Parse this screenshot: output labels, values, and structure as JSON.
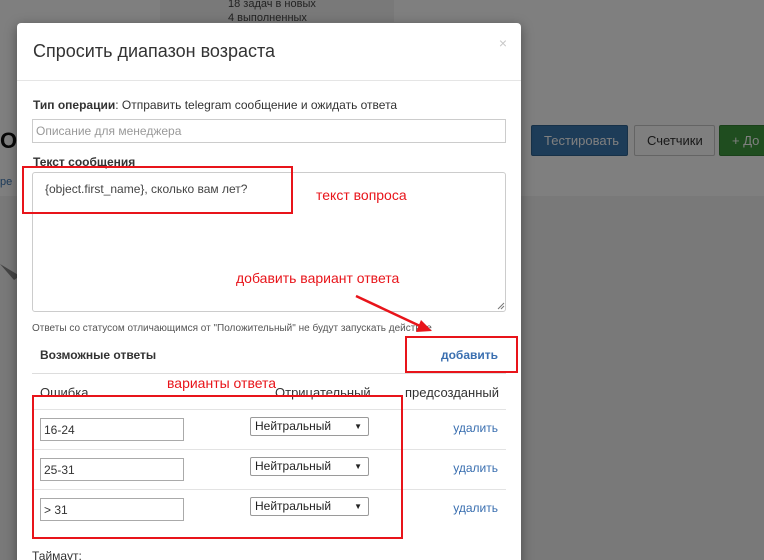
{
  "background": {
    "card_line1": "18 задач в новых",
    "card_line2": "4 выполненных",
    "heading": "О",
    "sub": "ре",
    "buttons": {
      "test": "Тестировать",
      "counters": "Счетчики",
      "add": "+ До"
    }
  },
  "modal": {
    "title": "Спросить диапазон возраста",
    "close": "×",
    "operation_label": "Тип операции",
    "operation_value": ": Отправить telegram сообщение и ожидать ответа",
    "description_placeholder": "Описание для менеджера",
    "message_label": "Текст сообщения",
    "message_text": "{object.first_name}, сколько вам лет?",
    "note": "Ответы со статусом отличающимся от \"Положительный\" не будут запускать действие",
    "answers_title": "Возможные ответы",
    "add_label": "добавить",
    "columns": {
      "error": "Ошибка",
      "negative": "Отрицательный",
      "precreated": "предсозданный"
    },
    "answers": [
      {
        "value": "16-24",
        "status": "Нейтральный",
        "delete_label": "удалить"
      },
      {
        "value": "25-31",
        "status": "Нейтральный",
        "delete_label": "удалить"
      },
      {
        "value": "> 31",
        "status": "Нейтральный",
        "delete_label": "удалить"
      }
    ],
    "timeout_label": "Таймаут:"
  },
  "annotations": {
    "question_text": "текст вопроса",
    "add_variant": "добавить вариант ответа",
    "variants": "варианты ответа",
    "color": "#e8141a"
  }
}
